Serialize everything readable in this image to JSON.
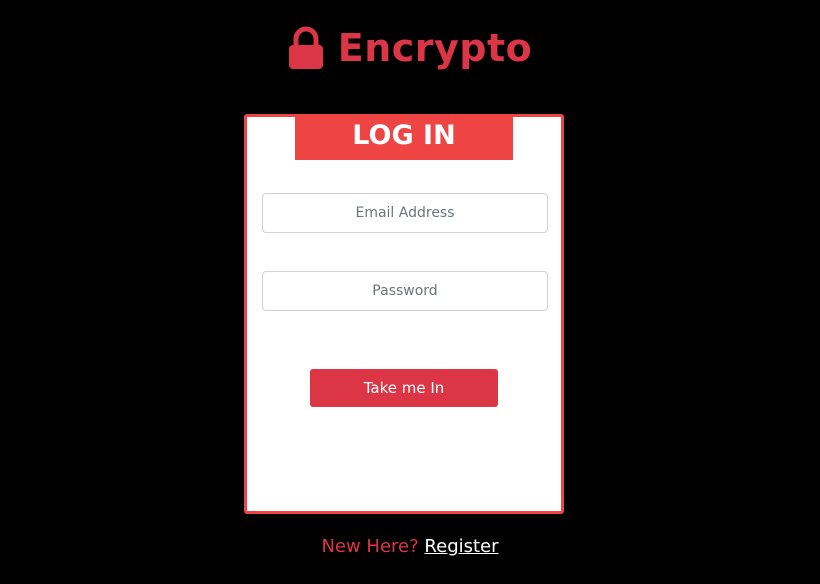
{
  "brand": {
    "title": "Encrypto",
    "icon": "lock-icon"
  },
  "login_card": {
    "header": "LOG IN",
    "email_placeholder": "Email Address",
    "email_value": "",
    "password_placeholder": "Password",
    "password_value": "",
    "submit_label": "Take me In"
  },
  "footer": {
    "prompt": "New Here?",
    "link_label": "Register"
  },
  "colors": {
    "background": "#000000",
    "accent": "#dc3545",
    "header_bg": "#ef4444",
    "card_bg": "#ffffff"
  }
}
